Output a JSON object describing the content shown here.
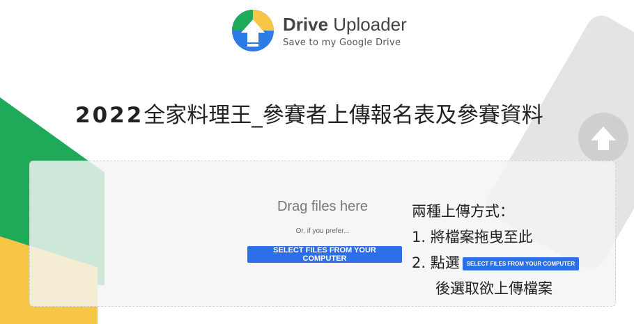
{
  "header": {
    "brand_bold": "Drive",
    "brand_rest": " Uploader",
    "subtitle": "Save to my Google Drive"
  },
  "page_title": {
    "year": "2022",
    "text": "全家料理王_參賽者上傳報名表及參賽資料"
  },
  "dropzone": {
    "drag_text": "Drag files here",
    "or_text": "Or, if you prefer...",
    "select_button": "SELECT FILES FROM YOUR COMPUTER"
  },
  "instructions": {
    "heading": "兩種上傳方式：",
    "step1": "1. 將檔案拖曳至此",
    "step2_prefix": "2. 點選",
    "step2_button": "SELECT FILES FROM YOUR COMPUTER",
    "step2_suffix": "後選取欲上傳檔案"
  },
  "colors": {
    "accent_blue": "#2d6fe8",
    "bg_green": "#1faa59",
    "bg_yellow": "#f8c646",
    "bg_grey": "#e4e4e4"
  },
  "icons": {
    "logo": "drive-uploader-logo-icon"
  }
}
